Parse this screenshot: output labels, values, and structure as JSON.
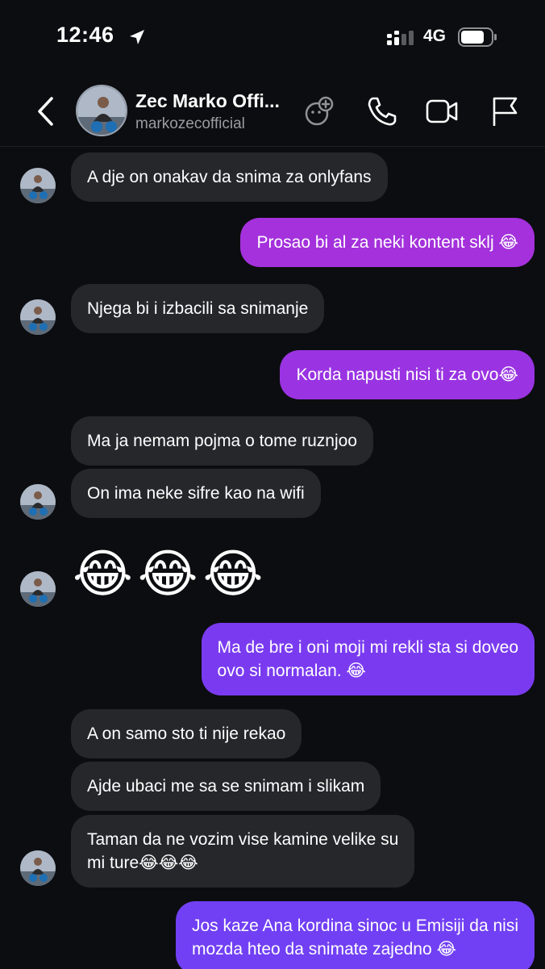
{
  "status_bar": {
    "time": "12:46",
    "location_icon": "location-arrow-icon",
    "signal_icon": "cellular-signal-icon",
    "network": "4G",
    "battery_icon": "battery-icon"
  },
  "header": {
    "back_icon": "chevron-left-icon",
    "contact_name": "Zec Marko Offi...",
    "handle": "markozecofficial",
    "actions": [
      "effects-icon",
      "phone-icon",
      "video-camera-icon",
      "flag-icon"
    ]
  },
  "colors": {
    "background": "#0c0d10",
    "incoming_bubble": "#26272b",
    "outgoing_bubble_magenta": "#a431dc",
    "outgoing_bubble_violet": "#7a3bf0",
    "secondary_text": "#9a9ca3"
  },
  "messages": [
    {
      "direction": "in",
      "text": "A dje on onakav da snima za onlyfans"
    },
    {
      "direction": "out",
      "text": "Prosao bi al za neki kontent sklj 😂"
    },
    {
      "direction": "in",
      "text": "Njega bi i izbacili sa snimanje"
    },
    {
      "direction": "out",
      "text": "Korda napusti nisi ti za ovo😂"
    },
    {
      "direction": "in",
      "text": "Ma ja nemam pojma o tome ruznjoo"
    },
    {
      "direction": "in",
      "text": "On ima neke sifre kao na wifi"
    },
    {
      "direction": "in",
      "text": "😂😂😂"
    },
    {
      "direction": "out",
      "lines": [
        "Ma de bre i oni moji mi rekli sta si doveo",
        "ovo si normalan. 😂"
      ]
    },
    {
      "direction": "in",
      "text": "A on samo sto ti nije rekao"
    },
    {
      "direction": "in",
      "text": "Ajde ubaci me sa se snimam i slikam"
    },
    {
      "direction": "in",
      "lines": [
        "Taman da ne vozim vise kamine velike su",
        "mi ture😂😂😂"
      ]
    },
    {
      "direction": "out",
      "lines": [
        "Jos kaze Ana kordina sinoc u Emisiji da nisi",
        "mozda hteo da snimate zajedno 😂"
      ]
    }
  ]
}
